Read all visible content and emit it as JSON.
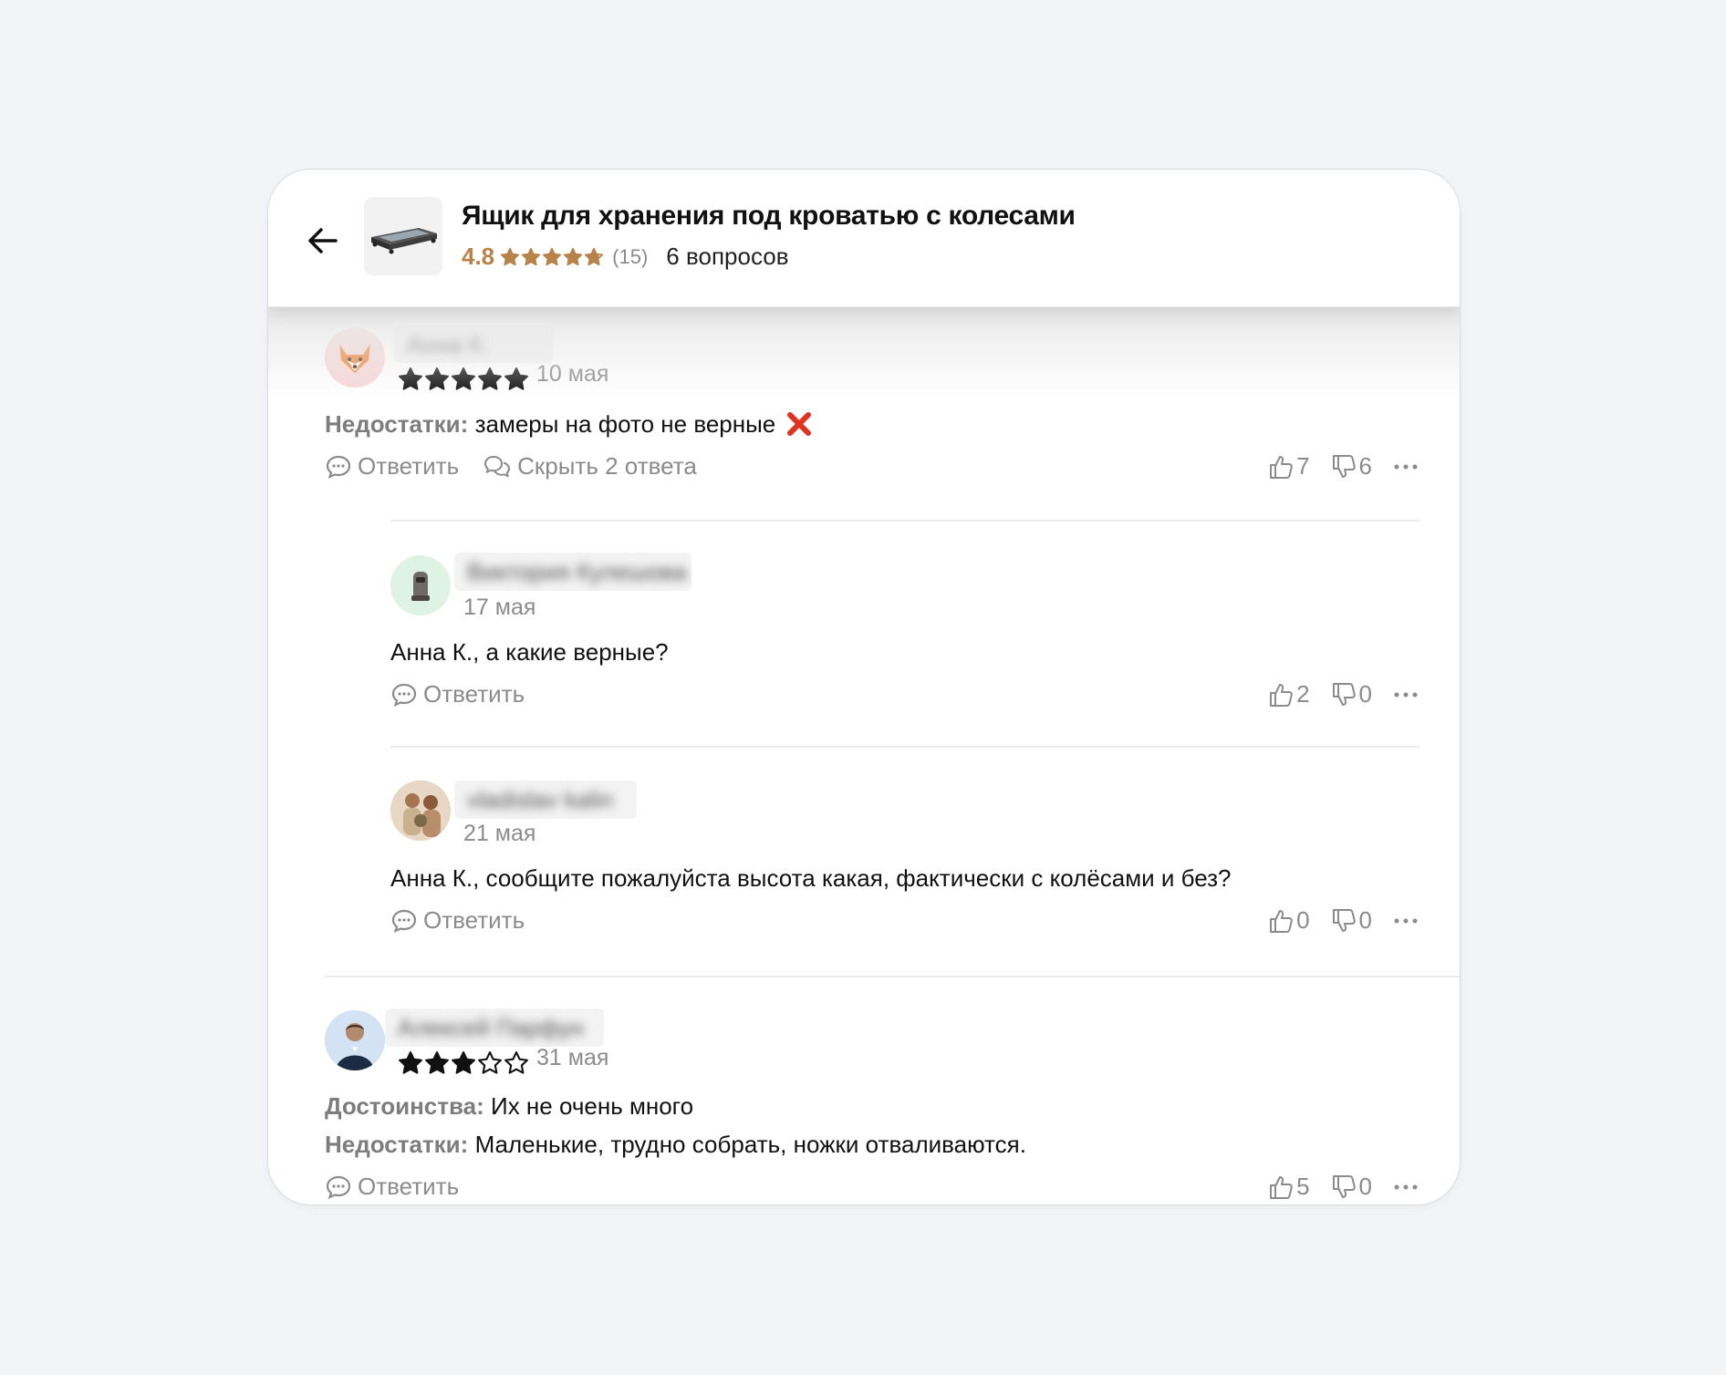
{
  "product": {
    "title": "Ящик для хранения под кроватью с колесами",
    "rating": "4.8",
    "rating_value": 4.8,
    "reviews_count": "(15)",
    "questions_link": "6 вопросов"
  },
  "icons": {
    "back": "arrow-left-icon",
    "reply": "speech-bubble-icon",
    "replies": "two-bubbles-icon",
    "like": "thumb-up-icon",
    "dislike": "thumb-down-icon",
    "more": "ellipsis-icon",
    "cross": "red-cross-mark-icon"
  },
  "colors": {
    "rating": "#b8834a",
    "muted": "#8b8b8b",
    "star": "#111111",
    "cross": "#e0321e"
  },
  "reviews": [
    {
      "author": "Анна К.",
      "stars": 5,
      "date": "10 мая",
      "cons_label": "Недостатки:",
      "cons_text": "замеры на фото не верные",
      "reply": "Ответить",
      "toggle_replies": "Скрыть 2 ответа",
      "likes": "7",
      "dislikes": "6"
    },
    {
      "author": "Алексей Парфун",
      "stars": 3,
      "date": "31 мая",
      "pros_label": "Достоинства:",
      "pros_text": "Их не очень много",
      "cons_label": "Недостатки:",
      "cons_text": "Маленькие, трудно собрать, ножки отваливаются.",
      "reply": "Ответить",
      "likes": "5",
      "dislikes": "0"
    }
  ],
  "replies": [
    {
      "author": "Виктория Кулешова",
      "date": "17 мая",
      "text": "Анна К., а какие верные?",
      "reply": "Ответить",
      "likes": "2",
      "dislikes": "0"
    },
    {
      "author": "vladislav kalin",
      "date": "21 мая",
      "text": "Анна К., сообщите пожалуйста высота какая, фактически с колёсами и без?",
      "reply": "Ответить",
      "likes": "0",
      "dislikes": "0"
    }
  ]
}
